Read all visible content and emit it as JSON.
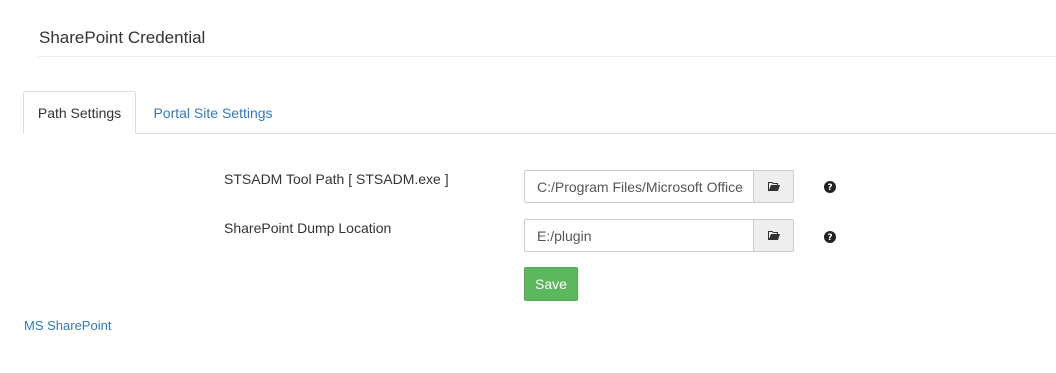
{
  "header": {
    "title": "SharePoint Credential"
  },
  "tabs": [
    {
      "label": "Path Settings",
      "active": true
    },
    {
      "label": "Portal Site Settings",
      "active": false
    }
  ],
  "form": {
    "stsadm_path": {
      "label": "STSADM Tool Path [ STSADM.exe ]",
      "value": "C:/Program Files/Microsoft Office",
      "browse_icon": "folder-open-icon",
      "help_icon": "question-circle-icon"
    },
    "dump_location": {
      "label": "SharePoint Dump Location",
      "value": "E:/plugin",
      "browse_icon": "folder-open-icon",
      "help_icon": "question-circle-icon"
    },
    "save_label": "Save"
  },
  "footer": {
    "link_label": "MS SharePoint"
  },
  "colors": {
    "link": "#337ab7",
    "save_button": "#5cb85c",
    "text": "#333333"
  }
}
